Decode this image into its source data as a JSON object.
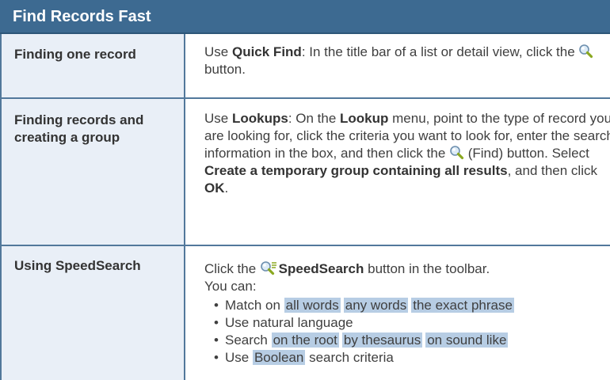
{
  "header": {
    "title": "Find Records Fast"
  },
  "rows": [
    {
      "label": "Finding one record",
      "text_parts": {
        "p1": "Use ",
        "b1": "Quick Find",
        "p2": ": In the title bar of a list or detail view, click the ",
        "p3": " button."
      }
    },
    {
      "label": "Finding records and creating a group",
      "text_parts": {
        "p1": "Use ",
        "b1": "Lookups",
        "p2": ": On the ",
        "b2": "Lookup",
        "p3": " menu, point to the type of record you are looking for, click the criteria you want to look for, enter the search information in the box, and then click the ",
        "p4": " (Find) button. Select ",
        "b3": "Create a temporary group containing all results",
        "p5": ", and then click ",
        "b4": "OK",
        "p6": "."
      }
    },
    {
      "label": "Using SpeedSearch",
      "text_parts": {
        "p1": "Click the ",
        "b1": "SpeedSearch",
        "p2": " button in the toolbar.",
        "p3": "You can:"
      },
      "bullets": [
        {
          "prefix": "Match on ",
          "highlights": [
            "all words",
            "any words",
            "the exact phrase"
          ]
        },
        {
          "prefix": "Use natural language",
          "highlights": []
        },
        {
          "prefix": "Search ",
          "highlights": [
            "on the root",
            "by thesaurus",
            "on sound like"
          ]
        },
        {
          "prefix": "Use ",
          "highlight": "Boolean",
          "suffix": " search criteria"
        }
      ]
    }
  ],
  "icons": {
    "quick_find": "magnifier-icon",
    "find": "magnifier-icon",
    "speedsearch": "speedsearch-magnifier-icon"
  },
  "colors": {
    "header_bg": "#3d6a91",
    "label_bg": "#e9eff7",
    "grid_line": "#52789b",
    "highlight": "#b7cde4"
  }
}
